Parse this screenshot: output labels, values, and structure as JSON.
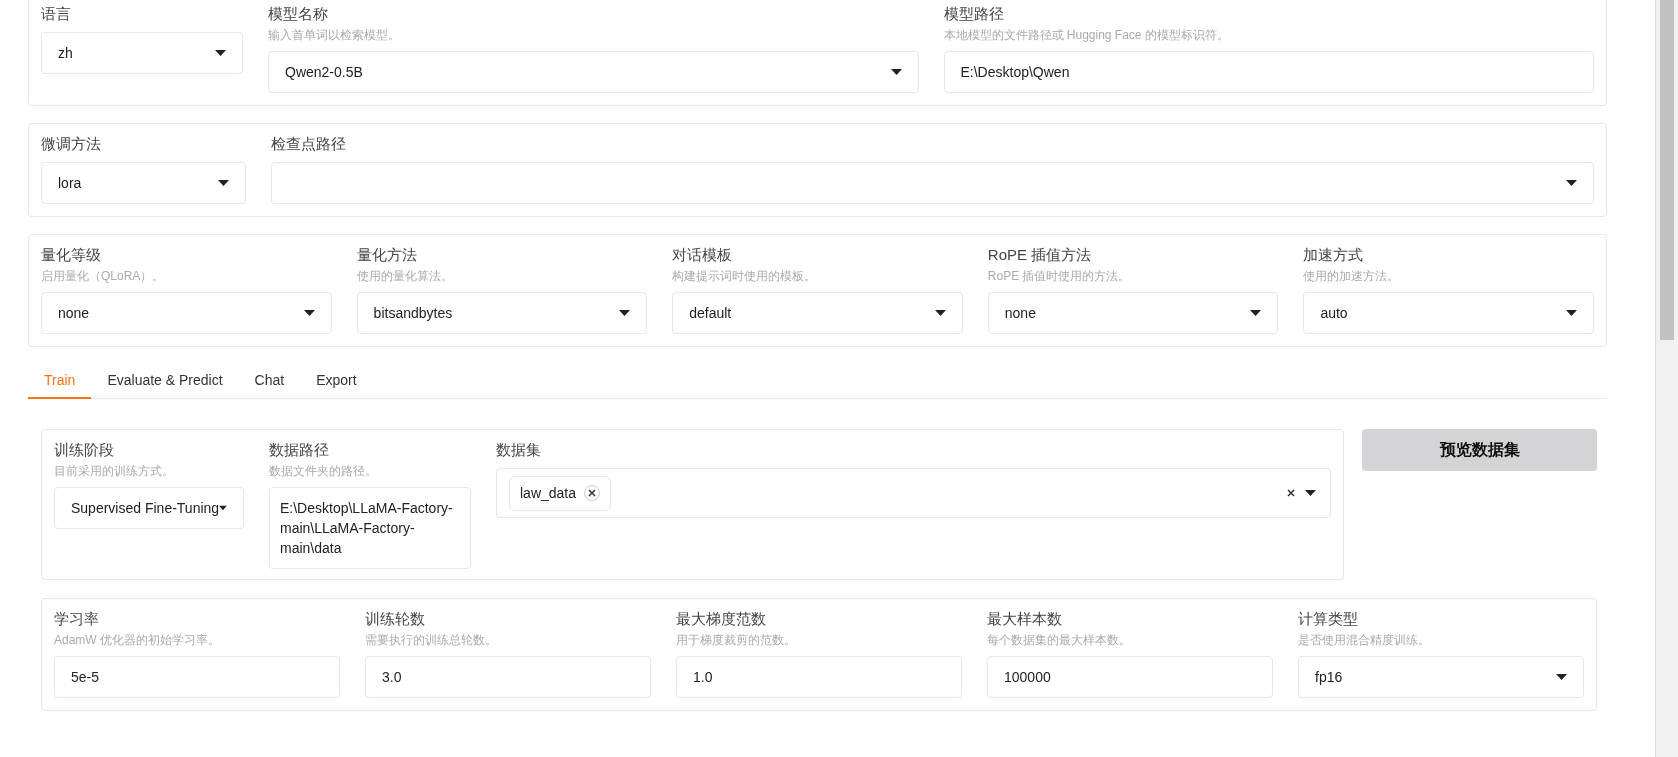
{
  "panels": [
    {
      "fields": [
        {
          "kind": "dropdown",
          "label": "语言",
          "value": "zh"
        },
        {
          "kind": "dropdown",
          "label": "模型名称",
          "hint": "输入首单词以检索模型。",
          "value": "Qwen2-0.5B"
        },
        {
          "kind": "text",
          "label": "模型路径",
          "hint": "本地模型的文件路径或 Hugging Face 的模型标识符。",
          "value": "E:\\Desktop\\Qwen"
        }
      ]
    },
    {
      "fields": [
        {
          "kind": "dropdown",
          "label": "微调方法",
          "value": "lora"
        },
        {
          "kind": "dropdown",
          "label": "检查点路径"
        }
      ]
    },
    {
      "fields": [
        {
          "kind": "dropdown",
          "label": "量化等级",
          "hint": "启用量化（QLoRA）。",
          "value": "none"
        },
        {
          "kind": "dropdown",
          "label": "量化方法",
          "hint": "使用的量化算法。",
          "value": "bitsandbytes"
        },
        {
          "kind": "dropdown",
          "label": "对话模板",
          "hint": "构建提示词时使用的模板。",
          "value": "default"
        },
        {
          "kind": "dropdown",
          "label": "RoPE 插值方法",
          "hint": "RoPE 插值时使用的方法。",
          "value": "none"
        },
        {
          "kind": "dropdown",
          "label": "加速方式",
          "hint": "使用的加速方法。",
          "value": "auto"
        }
      ]
    }
  ],
  "tabs": [
    {
      "label": "Train",
      "selected": true
    },
    {
      "label": "Evaluate & Predict",
      "selected": false
    },
    {
      "label": "Chat",
      "selected": false
    },
    {
      "label": "Export",
      "selected": false
    }
  ],
  "train_panel": {
    "fields": [
      {
        "kind": "dropdown",
        "label": "训练阶段",
        "hint": "目前采用的训练方式。",
        "value": "Supervised Fine-Tuning"
      },
      {
        "kind": "textarea",
        "label": "数据路径",
        "hint": "数据文件夹的路径。",
        "value": "E:\\Desktop\\LLaMA-Factory-main\\LLaMA-Factory-main\\data"
      },
      {
        "kind": "tags",
        "label": "数据集",
        "tags": [
          "law_data"
        ]
      }
    ]
  },
  "preview_button": "预览数据集",
  "params_panel": {
    "fields": [
      {
        "kind": "text",
        "label": "学习率",
        "hint": "AdamW 优化器的初始学习率。",
        "value": "5e-5"
      },
      {
        "kind": "text",
        "label": "训练轮数",
        "hint": "需要执行的训练总轮数。",
        "value": "3.0"
      },
      {
        "kind": "text",
        "label": "最大梯度范数",
        "hint": "用于梯度裁剪的范数。",
        "value": "1.0"
      },
      {
        "kind": "text",
        "label": "最大样本数",
        "hint": "每个数据集的最大样本数。",
        "value": "100000"
      },
      {
        "kind": "dropdown",
        "label": "计算类型",
        "hint": "是否使用混合精度训练。",
        "value": "fp16"
      }
    ]
  }
}
